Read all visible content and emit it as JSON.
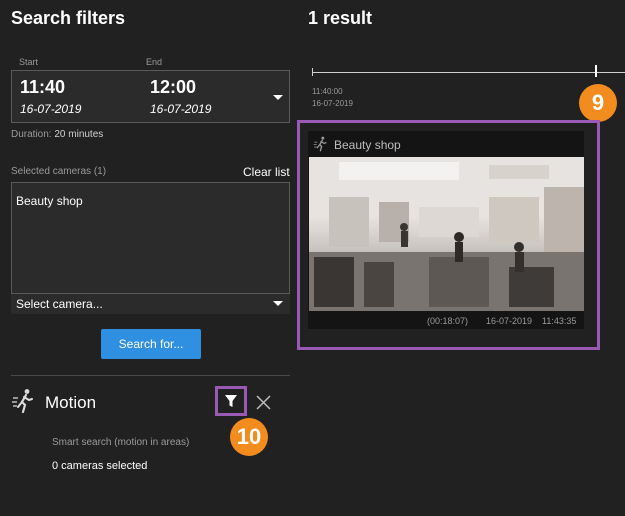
{
  "left_panel": {
    "title": "Search filters",
    "start_label": "Start",
    "end_label": "End",
    "start_time": "11:40",
    "start_date": "16-07-2019",
    "end_time": "12:00",
    "end_date": "16-07-2019",
    "duration_label": "Duration:",
    "duration_value": "20 minutes",
    "selected_cameras_label": "Selected cameras (1)",
    "clear_list": "Clear list",
    "cameras": [
      "Beauty shop"
    ],
    "select_camera": "Select camera...",
    "search_button": "Search for...",
    "motion_title": "Motion",
    "motion_subtitle": "Smart search (motion in areas)",
    "motion_cameras": "0 cameras selected",
    "callout_filter": "10"
  },
  "right_panel": {
    "title": "1 result",
    "timeline_time": "11:40:00",
    "timeline_date": "16-07-2019",
    "callout_result": "9",
    "result": {
      "camera_name": "Beauty shop",
      "offset": "(00:18:07)",
      "date": "16-07-2019",
      "time": "11:43:35"
    }
  },
  "colors": {
    "background": "#212121",
    "accent_button": "#2f8fe0",
    "highlight_frame": "#9b59b6",
    "callout": "#f28c1e"
  },
  "icons": [
    "chevron-down-icon",
    "motion-walker-icon",
    "filter-icon",
    "close-icon"
  ]
}
